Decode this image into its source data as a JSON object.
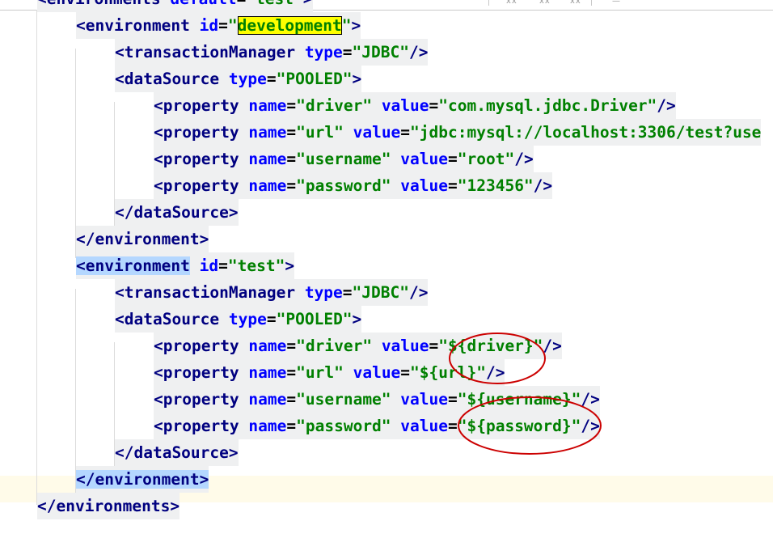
{
  "editor": {
    "lines": [
      {
        "id": "environments-open",
        "indent": 1,
        "tokens": [
          {
            "t": "<",
            "c": "tag"
          },
          {
            "t": "environments",
            "c": "tag"
          },
          {
            "t": " ",
            "c": "punc"
          },
          {
            "t": "default",
            "c": "attr"
          },
          {
            "t": "=",
            "c": "punc"
          },
          {
            "t": "\"test\"",
            "c": "val"
          },
          {
            "t": ">",
            "c": "tag"
          }
        ]
      },
      {
        "id": "environment-development-open",
        "indent": 2,
        "tokens": [
          {
            "t": "<",
            "c": "tag"
          },
          {
            "t": "environment",
            "c": "tag"
          },
          {
            "t": " ",
            "c": "punc"
          },
          {
            "t": "id",
            "c": "attr"
          },
          {
            "t": "=",
            "c": "punc"
          },
          {
            "t": "\"",
            "c": "val"
          },
          {
            "t": "development",
            "c": "val",
            "hl": "yellow"
          },
          {
            "t": "\"",
            "c": "val"
          },
          {
            "t": ">",
            "c": "tag"
          }
        ]
      },
      {
        "id": "transaction-manager-dev",
        "indent": 3,
        "tokens": [
          {
            "t": "<",
            "c": "tag"
          },
          {
            "t": "transactionManager",
            "c": "tag"
          },
          {
            "t": " ",
            "c": "punc"
          },
          {
            "t": "type",
            "c": "attr"
          },
          {
            "t": "=",
            "c": "punc"
          },
          {
            "t": "\"JDBC\"",
            "c": "val"
          },
          {
            "t": "/>",
            "c": "tag"
          }
        ]
      },
      {
        "id": "datasource-dev-open",
        "indent": 3,
        "tokens": [
          {
            "t": "<",
            "c": "tag"
          },
          {
            "t": "dataSource",
            "c": "tag"
          },
          {
            "t": " ",
            "c": "punc"
          },
          {
            "t": "type",
            "c": "attr"
          },
          {
            "t": "=",
            "c": "punc"
          },
          {
            "t": "\"POOLED\"",
            "c": "val"
          },
          {
            "t": ">",
            "c": "tag"
          }
        ]
      },
      {
        "id": "property-driver-dev",
        "indent": 4,
        "tokens": [
          {
            "t": "<",
            "c": "tag"
          },
          {
            "t": "property",
            "c": "tag"
          },
          {
            "t": " ",
            "c": "punc"
          },
          {
            "t": "name",
            "c": "attr"
          },
          {
            "t": "=",
            "c": "punc"
          },
          {
            "t": "\"driver\"",
            "c": "val"
          },
          {
            "t": " ",
            "c": "punc"
          },
          {
            "t": "value",
            "c": "attr"
          },
          {
            "t": "=",
            "c": "punc"
          },
          {
            "t": "\"com.mysql.jdbc.Driver\"",
            "c": "val"
          },
          {
            "t": "/>",
            "c": "tag"
          }
        ]
      },
      {
        "id": "property-url-dev",
        "indent": 4,
        "tokens": [
          {
            "t": "<",
            "c": "tag"
          },
          {
            "t": "property",
            "c": "tag"
          },
          {
            "t": " ",
            "c": "punc"
          },
          {
            "t": "name",
            "c": "attr"
          },
          {
            "t": "=",
            "c": "punc"
          },
          {
            "t": "\"url\"",
            "c": "val"
          },
          {
            "t": " ",
            "c": "punc"
          },
          {
            "t": "value",
            "c": "attr"
          },
          {
            "t": "=",
            "c": "punc"
          },
          {
            "t": "\"jdbc:mysql://localhost:3306/test?use",
            "c": "val"
          }
        ]
      },
      {
        "id": "property-username-dev",
        "indent": 4,
        "tokens": [
          {
            "t": "<",
            "c": "tag"
          },
          {
            "t": "property",
            "c": "tag"
          },
          {
            "t": " ",
            "c": "punc"
          },
          {
            "t": "name",
            "c": "attr"
          },
          {
            "t": "=",
            "c": "punc"
          },
          {
            "t": "\"username\"",
            "c": "val"
          },
          {
            "t": " ",
            "c": "punc"
          },
          {
            "t": "value",
            "c": "attr"
          },
          {
            "t": "=",
            "c": "punc"
          },
          {
            "t": "\"root\"",
            "c": "val"
          },
          {
            "t": "/>",
            "c": "tag"
          }
        ]
      },
      {
        "id": "property-password-dev",
        "indent": 4,
        "tokens": [
          {
            "t": "<",
            "c": "tag"
          },
          {
            "t": "property",
            "c": "tag"
          },
          {
            "t": " ",
            "c": "punc"
          },
          {
            "t": "name",
            "c": "attr"
          },
          {
            "t": "=",
            "c": "punc"
          },
          {
            "t": "\"password\"",
            "c": "val"
          },
          {
            "t": " ",
            "c": "punc"
          },
          {
            "t": "value",
            "c": "attr"
          },
          {
            "t": "=",
            "c": "punc"
          },
          {
            "t": "\"123456\"",
            "c": "val"
          },
          {
            "t": "/>",
            "c": "tag"
          }
        ]
      },
      {
        "id": "datasource-dev-close",
        "indent": 3,
        "tokens": [
          {
            "t": "</",
            "c": "tag"
          },
          {
            "t": "dataSource",
            "c": "tag"
          },
          {
            "t": ">",
            "c": "tag"
          }
        ]
      },
      {
        "id": "environment-development-close",
        "indent": 2,
        "tokens": [
          {
            "t": "</",
            "c": "tag"
          },
          {
            "t": "environment",
            "c": "tag"
          },
          {
            "t": ">",
            "c": "tag"
          }
        ]
      },
      {
        "id": "environment-test-open",
        "indent": 2,
        "tokens": [
          {
            "t": "<",
            "c": "tag",
            "hl": "blue"
          },
          {
            "t": "environment",
            "c": "tag",
            "hl": "blue"
          },
          {
            "t": " ",
            "c": "punc"
          },
          {
            "t": "id",
            "c": "attr"
          },
          {
            "t": "=",
            "c": "punc"
          },
          {
            "t": "\"test\"",
            "c": "val"
          },
          {
            "t": ">",
            "c": "tag"
          }
        ]
      },
      {
        "id": "transaction-manager-test",
        "indent": 3,
        "tokens": [
          {
            "t": "<",
            "c": "tag"
          },
          {
            "t": "transactionManager",
            "c": "tag"
          },
          {
            "t": " ",
            "c": "punc"
          },
          {
            "t": "type",
            "c": "attr"
          },
          {
            "t": "=",
            "c": "punc"
          },
          {
            "t": "\"JDBC\"",
            "c": "val"
          },
          {
            "t": "/>",
            "c": "tag"
          }
        ]
      },
      {
        "id": "datasource-test-open",
        "indent": 3,
        "tokens": [
          {
            "t": "<",
            "c": "tag"
          },
          {
            "t": "dataSource",
            "c": "tag"
          },
          {
            "t": " ",
            "c": "punc"
          },
          {
            "t": "type",
            "c": "attr"
          },
          {
            "t": "=",
            "c": "punc"
          },
          {
            "t": "\"POOLED\"",
            "c": "val"
          },
          {
            "t": ">",
            "c": "tag"
          }
        ]
      },
      {
        "id": "property-driver-test",
        "indent": 4,
        "tokens": [
          {
            "t": "<",
            "c": "tag"
          },
          {
            "t": "property",
            "c": "tag"
          },
          {
            "t": " ",
            "c": "punc"
          },
          {
            "t": "name",
            "c": "attr"
          },
          {
            "t": "=",
            "c": "punc"
          },
          {
            "t": "\"driver\"",
            "c": "val"
          },
          {
            "t": " ",
            "c": "punc"
          },
          {
            "t": "value",
            "c": "attr"
          },
          {
            "t": "=",
            "c": "punc"
          },
          {
            "t": "\"${driver}\"",
            "c": "val"
          },
          {
            "t": "/>",
            "c": "tag"
          }
        ]
      },
      {
        "id": "property-url-test",
        "indent": 4,
        "tokens": [
          {
            "t": "<",
            "c": "tag"
          },
          {
            "t": "property",
            "c": "tag"
          },
          {
            "t": " ",
            "c": "punc"
          },
          {
            "t": "name",
            "c": "attr"
          },
          {
            "t": "=",
            "c": "punc"
          },
          {
            "t": "\"url\"",
            "c": "val"
          },
          {
            "t": " ",
            "c": "punc"
          },
          {
            "t": "value",
            "c": "attr"
          },
          {
            "t": "=",
            "c": "punc"
          },
          {
            "t": "\"${url}\"",
            "c": "val"
          },
          {
            "t": "/>",
            "c": "tag"
          }
        ]
      },
      {
        "id": "property-username-test",
        "indent": 4,
        "tokens": [
          {
            "t": "<",
            "c": "tag"
          },
          {
            "t": "property",
            "c": "tag"
          },
          {
            "t": " ",
            "c": "punc"
          },
          {
            "t": "name",
            "c": "attr"
          },
          {
            "t": "=",
            "c": "punc"
          },
          {
            "t": "\"username\"",
            "c": "val"
          },
          {
            "t": " ",
            "c": "punc"
          },
          {
            "t": "value",
            "c": "attr"
          },
          {
            "t": "=",
            "c": "punc"
          },
          {
            "t": "\"${username}\"",
            "c": "val"
          },
          {
            "t": "/>",
            "c": "tag"
          }
        ]
      },
      {
        "id": "property-password-test",
        "indent": 4,
        "tokens": [
          {
            "t": "<",
            "c": "tag"
          },
          {
            "t": "property",
            "c": "tag"
          },
          {
            "t": " ",
            "c": "punc"
          },
          {
            "t": "name",
            "c": "attr"
          },
          {
            "t": "=",
            "c": "punc"
          },
          {
            "t": "\"password\"",
            "c": "val"
          },
          {
            "t": " ",
            "c": "punc"
          },
          {
            "t": "value",
            "c": "attr"
          },
          {
            "t": "=",
            "c": "punc"
          },
          {
            "t": "\"${password}\"",
            "c": "val"
          },
          {
            "t": "/>",
            "c": "tag"
          }
        ]
      },
      {
        "id": "datasource-test-close",
        "indent": 3,
        "tokens": [
          {
            "t": "</",
            "c": "tag"
          },
          {
            "t": "dataSource",
            "c": "tag"
          },
          {
            "t": ">",
            "c": "tag"
          }
        ]
      },
      {
        "id": "environment-test-close",
        "indent": 2,
        "tokens": [
          {
            "t": "</",
            "c": "tag",
            "hl": "blue"
          },
          {
            "t": "environment",
            "c": "tag",
            "hl": "blue"
          },
          {
            "t": ">",
            "c": "tag",
            "hl": "blue"
          }
        ]
      },
      {
        "id": "environments-close",
        "indent": 1,
        "tokens": [
          {
            "t": "</",
            "c": "tag"
          },
          {
            "t": "environments",
            "c": "tag"
          },
          {
            "t": ">",
            "c": "tag"
          }
        ]
      }
    ]
  },
  "colors": {
    "tag": "#000080",
    "attribute": "#0000ff",
    "value": "#008000",
    "search-highlight": "#ffff00",
    "brace-match-highlight": "#b4d7ff",
    "annotation-circle": "#cc0000"
  }
}
